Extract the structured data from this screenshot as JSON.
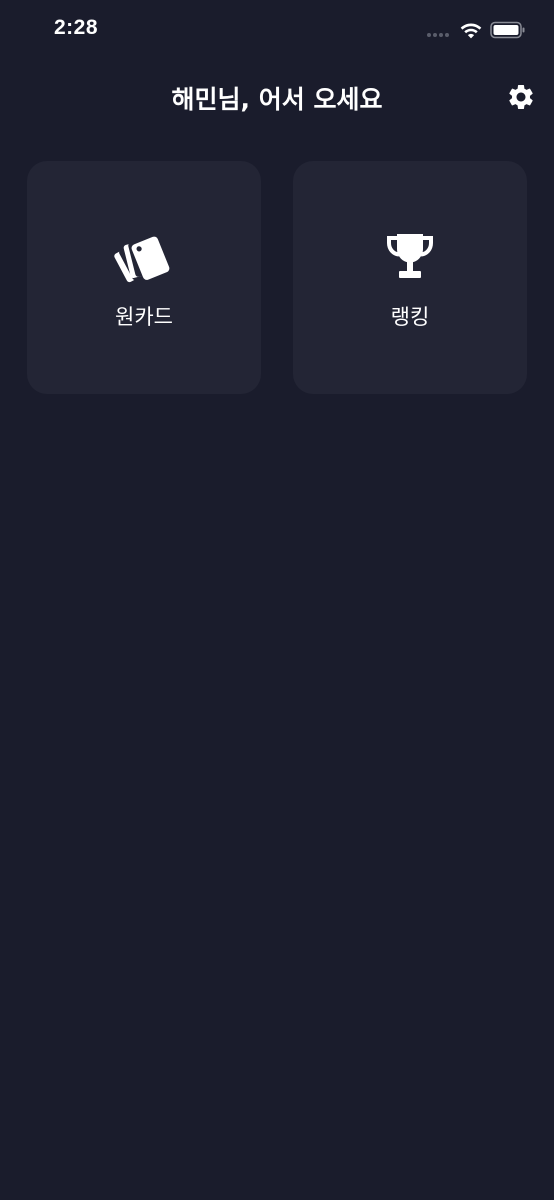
{
  "status_bar": {
    "time": "2:28",
    "icons": [
      "signal-dots-icon",
      "wifi-icon",
      "battery-icon"
    ]
  },
  "header": {
    "title": "해민님, 어서 오세요",
    "settings_icon": "gear-icon"
  },
  "menu": {
    "items": [
      {
        "label": "원카드",
        "icon": "cards-icon"
      },
      {
        "label": "랭킹",
        "icon": "trophy-icon"
      }
    ]
  },
  "colors": {
    "background": "#1a1c2c",
    "tile": "#232535",
    "text": "#ffffff"
  }
}
